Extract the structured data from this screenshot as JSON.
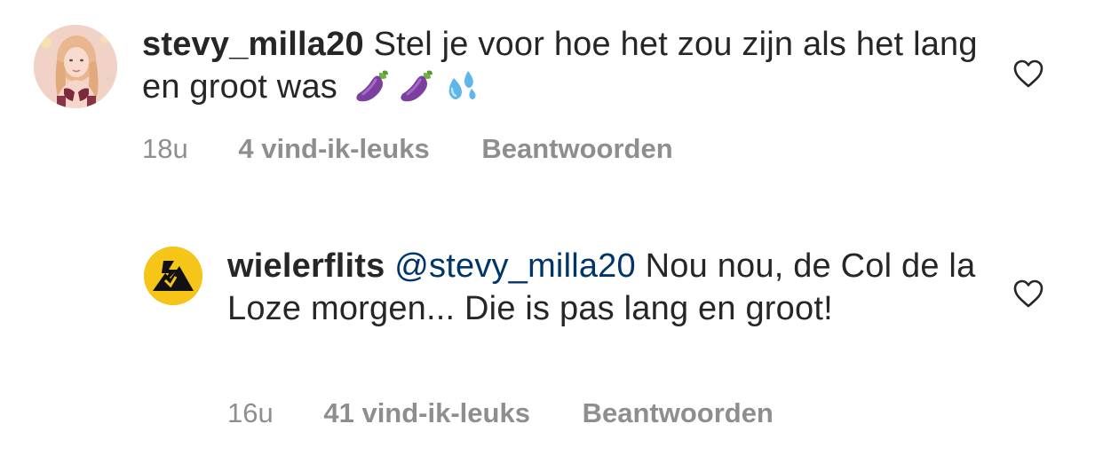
{
  "comments": [
    {
      "username": "stevy_milla20",
      "mention": "",
      "text": "Stel je voor hoe het zou zijn als het lang en groot was",
      "emojis": [
        "eggplant-emoji",
        "eggplant-emoji",
        "sweat-droplets-emoji"
      ],
      "time": "18u",
      "likes": "4 vind-ik-leuks",
      "reply_label": "Beantwoorden",
      "like_icon": "heart-outline-icon"
    },
    {
      "username": "wielerflits",
      "mention": "@stevy_milla20",
      "text": "Nou nou, de Col de la Loze morgen... Die is pas lang en groot!",
      "emojis": [],
      "time": "16u",
      "likes": "41 vind-ik-leuks",
      "reply_label": "Beantwoorden",
      "like_icon": "heart-outline-icon"
    }
  ],
  "colors": {
    "text": "#262626",
    "secondary": "#8e8e8e",
    "mention": "#003569",
    "brand_yellow": "#f5c518"
  }
}
